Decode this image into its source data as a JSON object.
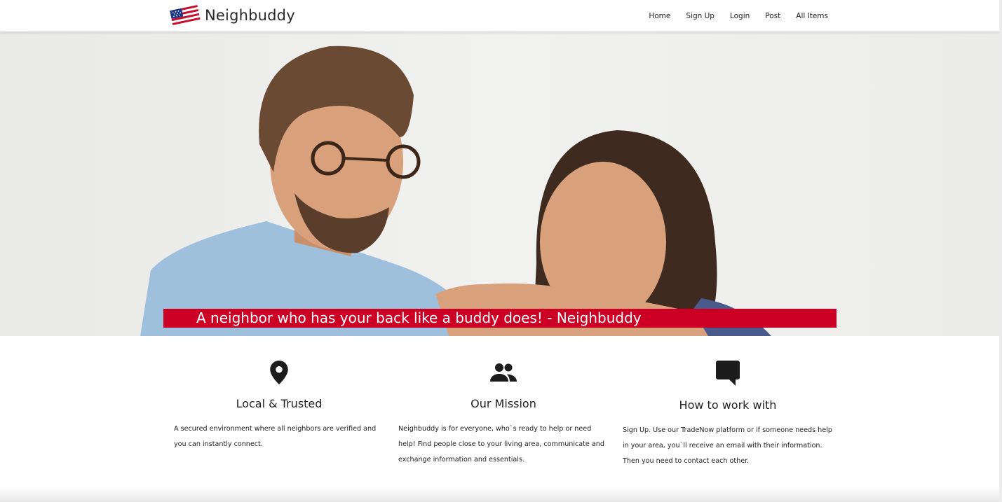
{
  "navbar": {
    "brand": "Neighbuddy",
    "links": [
      "Home",
      "Sign Up",
      "Login",
      "Post",
      "All Items"
    ]
  },
  "hero": {
    "tagline": "A neighbor who has your back like a buddy does! - Neighbuddy"
  },
  "features": [
    {
      "icon": "location-pin-icon",
      "title": "Local & Trusted",
      "text": "A secured environment where all neighbors are verified and you can instantly connect."
    },
    {
      "icon": "people-icon",
      "title": "Our Mission",
      "text": "Neighbuddy is for everyone, who`s ready to help or need help! Find people close to your living area, communicate and exchange information and essentials."
    },
    {
      "icon": "chat-bubble-icon",
      "title": "How to work with",
      "text": "Sign Up. Use our TradeNow platform or if someone needs help in your area, you`ll receive an email with their information. Then you need to contact each other."
    }
  ],
  "colors": {
    "accent": "#cc0024",
    "nav_background": "#ffffff",
    "hero_background": "#ededeb"
  }
}
